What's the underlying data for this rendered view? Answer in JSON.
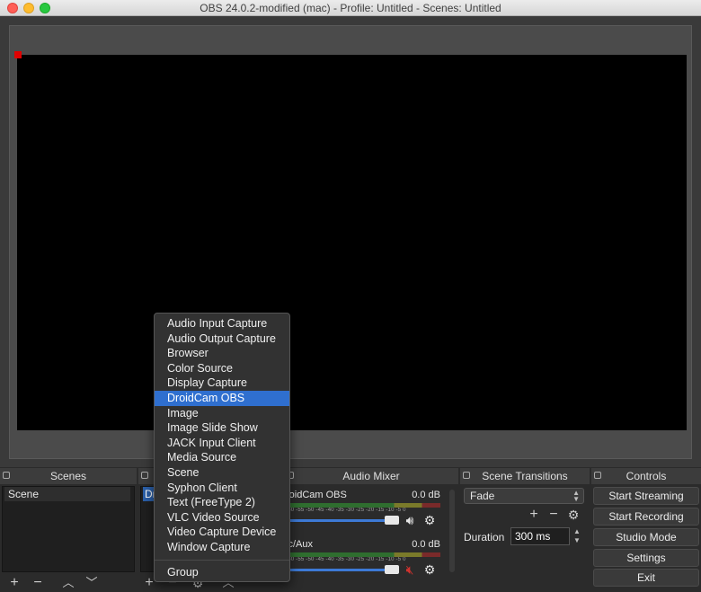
{
  "window": {
    "title": "OBS 24.0.2-modified (mac) - Profile: Untitled - Scenes: Untitled"
  },
  "scenes": {
    "header": "Scenes",
    "items": [
      "Scene"
    ]
  },
  "sources": {
    "selected_item": "Dr"
  },
  "add_source_menu": {
    "items": [
      "Audio Input Capture",
      "Audio Output Capture",
      "Browser",
      "Color Source",
      "Display Capture",
      "DroidCam OBS",
      "Image",
      "Image Slide Show",
      "JACK Input Client",
      "Media Source",
      "Scene",
      "Syphon Client",
      "Text (FreeType 2)",
      "VLC Video Source",
      "Video Capture Device",
      "Window Capture"
    ],
    "highlighted": "DroidCam OBS",
    "group_item": "Group"
  },
  "audio_mixer": {
    "header": "Audio Mixer",
    "tracks": [
      {
        "name": "roidCam OBS",
        "db": "0.0 dB",
        "muted": false
      },
      {
        "name": "ic/Aux",
        "db": "0.0 dB",
        "muted": true
      }
    ],
    "meter_scale": "-60 -55 -50 -45 -40 -35 -30 -25 -20 -15 -10 -5 0"
  },
  "scene_transitions": {
    "header": "Scene Transitions",
    "transition": "Fade",
    "duration_label": "Duration",
    "duration_value": "300 ms"
  },
  "controls": {
    "header": "Controls",
    "start_streaming": "Start Streaming",
    "start_recording": "Start Recording",
    "studio_mode": "Studio Mode",
    "settings": "Settings",
    "exit": "Exit"
  },
  "colors": {
    "menu_highlight": "#2f6fcf",
    "selected_source": "#2a5fa8",
    "mute_red": "#d0322e",
    "preview_handle": "#e00000"
  }
}
